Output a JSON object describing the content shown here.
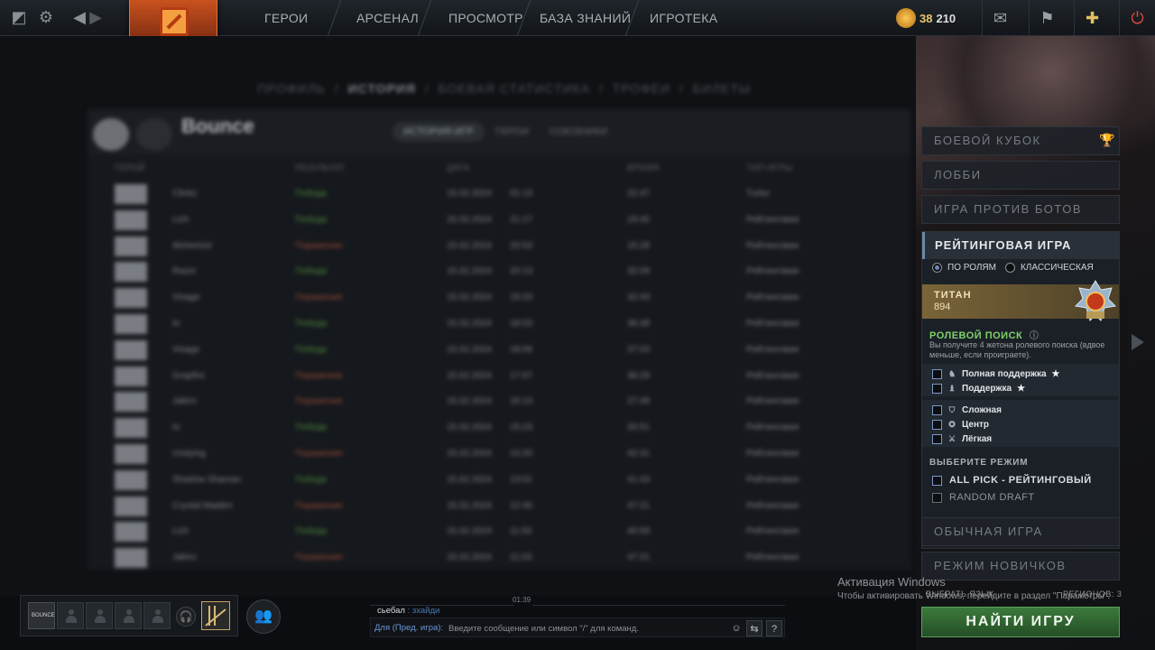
{
  "topbar": {
    "nav": [
      "ГЕРОИ",
      "АРСЕНАЛ",
      "ПРОСМОТР",
      "БАЗА ЗНАНИЙ",
      "ИГРОТЕКА"
    ],
    "currency": {
      "gold": "38",
      "shards": "210"
    }
  },
  "subnav": {
    "items": [
      "ПРОФИЛЬ",
      "ИСТОРИЯ",
      "БОЕВАЯ СТАТИСТИКА",
      "ТРОФЕИ",
      "БИЛЕТЫ"
    ]
  },
  "history": {
    "player_name": "Bounce",
    "tabs": [
      "ИСТОРИЯ ИГР",
      "ГЕРОИ",
      "СОЮЗНИКИ"
    ],
    "columns": [
      "ГЕРОЙ",
      "РЕЗУЛЬТАТ",
      "ДАТА",
      "ВРЕМЯ",
      "ТИП ИГРЫ"
    ],
    "rows": [
      {
        "hero": "Clinkz",
        "result": "Победа",
        "date": "15.02.2024",
        "clock": "01:13",
        "time": "22:47",
        "type": "Turbo"
      },
      {
        "hero": "Lich",
        "result": "Победа",
        "date": "15.02.2024",
        "clock": "21:17",
        "time": "19:40",
        "type": "Рейтинговая"
      },
      {
        "hero": "Alchemist",
        "result": "Поражение",
        "date": "15.02.2024",
        "clock": "20:53",
        "time": "15:28",
        "type": "Рейтинговая"
      },
      {
        "hero": "Razor",
        "result": "Победа",
        "date": "15.02.2024",
        "clock": "20:13",
        "time": "32:09",
        "type": "Рейтинговая"
      },
      {
        "hero": "Visage",
        "result": "Поражение",
        "date": "15.02.2024",
        "clock": "19:33",
        "time": "32:43",
        "type": "Рейтинговая"
      },
      {
        "hero": "Io",
        "result": "Победа",
        "date": "15.02.2024",
        "clock": "18:53",
        "time": "36:48",
        "type": "Рейтинговая"
      },
      {
        "hero": "Visage",
        "result": "Победа",
        "date": "15.02.2024",
        "clock": "18:06",
        "time": "37:03",
        "type": "Рейтинговая"
      },
      {
        "hero": "Grapfire",
        "result": "Поражение",
        "date": "15.02.2024",
        "clock": "17:07",
        "time": "38:29",
        "type": "Рейтинговая"
      },
      {
        "hero": "Jakiro",
        "result": "Поражение",
        "date": "15.02.2024",
        "clock": "16:13",
        "time": "27:49",
        "type": "Рейтинговая"
      },
      {
        "hero": "Io",
        "result": "Победа",
        "date": "15.02.2024",
        "clock": "15:23",
        "time": "26:51",
        "type": "Рейтинговая"
      },
      {
        "hero": "Undying",
        "result": "Поражение",
        "date": "15.02.2024",
        "clock": "14:20",
        "time": "42:31",
        "type": "Рейтинговая"
      },
      {
        "hero": "Shadow Shaman",
        "result": "Победа",
        "date": "15.02.2024",
        "clock": "13:01",
        "time": "41:43",
        "type": "Рейтинговая"
      },
      {
        "hero": "Crystal Maiden",
        "result": "Поражение",
        "date": "15.02.2024",
        "clock": "12:40",
        "time": "47:21",
        "type": "Рейтинговая"
      },
      {
        "hero": "Lich",
        "result": "Победа",
        "date": "15.02.2024",
        "clock": "11:53",
        "time": "40:59",
        "type": "Рейтинговая"
      },
      {
        "hero": "Jakiro",
        "result": "Поражение",
        "date": "15.02.2024",
        "clock": "11:03",
        "time": "47:21",
        "type": "Рейтинговая"
      }
    ]
  },
  "right_panel": {
    "modes": {
      "battle_cup": "БОЕВОЙ КУБОК",
      "lobby": "ЛОББИ",
      "bots": "ИГРА ПРОТИВ БОТОВ",
      "normal": "ОБЫЧНАЯ ИГРА",
      "newbie": "РЕЖИМ НОВИЧКОВ"
    },
    "ranked": {
      "title": "РЕЙТИНГОВАЯ ИГРА",
      "radio_roles": "ПО РОЛЯМ",
      "radio_classic": "КЛАССИЧЕСКАЯ",
      "rank_name": "ТИТАН",
      "rank_value": "894",
      "role_search_title": "РОЛЕВОЙ ПОИСК",
      "role_search_desc": "Вы получите 4 жетона ролевого поиска (вдвое меньше, если проиграете).",
      "roles_support": [
        "Полная поддержка",
        "Поддержка"
      ],
      "roles_core": [
        "Сложная",
        "Центр",
        "Лёгкая"
      ],
      "select_mode_title": "ВЫБЕРИТЕ РЕЖИМ",
      "mode_all_pick": "ALL PICK - РЕЙТИНГОВЫЙ",
      "mode_random_draft": "RANDOM DRAFT"
    },
    "find_game": "НАЙТИ ИГРУ"
  },
  "party": {
    "my_avatar": "BOUNCE"
  },
  "chat": {
    "time": "01:39",
    "sender": "сьебал",
    "message": ": зхайди",
    "channel": "Для (Пред. игра):",
    "placeholder": "Введите сообщение или символ \"/\" для команд."
  },
  "watermark": {
    "title": "Активация Windows",
    "text": "Чтобы активировать Windows, перейдите в раздел \"Параметры\".",
    "lang": "ВЫБРАТЬ ЯЗЫК",
    "regions": "РЕГИОНОВ: 3"
  }
}
